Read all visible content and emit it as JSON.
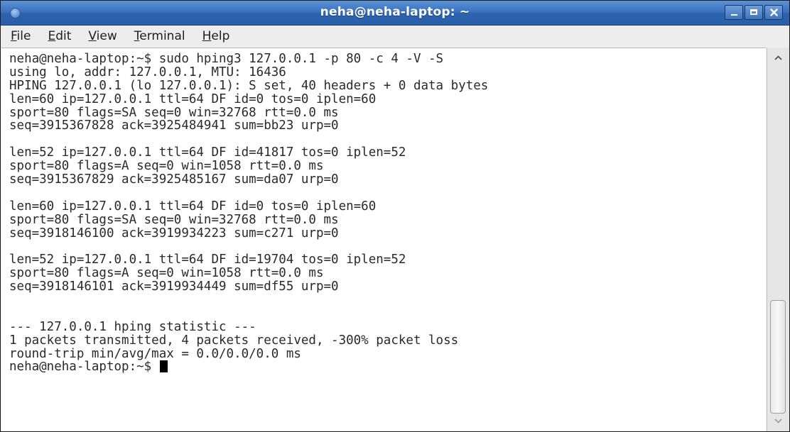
{
  "window": {
    "title": "neha@neha-laptop: ~"
  },
  "menu": [
    {
      "accel": "F",
      "rest": "ile"
    },
    {
      "accel": "E",
      "rest": "dit"
    },
    {
      "accel": "V",
      "rest": "iew"
    },
    {
      "accel": "T",
      "rest": "erminal"
    },
    {
      "accel": "H",
      "rest": "elp"
    }
  ],
  "terminal": {
    "lines": [
      "neha@neha-laptop:~$ sudo hping3 127.0.0.1 -p 80 -c 4 -V -S",
      "using lo, addr: 127.0.0.1, MTU: 16436",
      "HPING 127.0.0.1 (lo 127.0.0.1): S set, 40 headers + 0 data bytes",
      "len=60 ip=127.0.0.1 ttl=64 DF id=0 tos=0 iplen=60",
      "sport=80 flags=SA seq=0 win=32768 rtt=0.0 ms",
      "seq=3915367828 ack=3925484941 sum=bb23 urp=0",
      "",
      "len=52 ip=127.0.0.1 ttl=64 DF id=41817 tos=0 iplen=52",
      "sport=80 flags=A seq=0 win=1058 rtt=0.0 ms",
      "seq=3915367829 ack=3925485167 sum=da07 urp=0",
      "",
      "len=60 ip=127.0.0.1 ttl=64 DF id=0 tos=0 iplen=60",
      "sport=80 flags=SA seq=0 win=32768 rtt=0.0 ms",
      "seq=3918146100 ack=3919934223 sum=c271 urp=0",
      "",
      "len=52 ip=127.0.0.1 ttl=64 DF id=19704 tos=0 iplen=52",
      "sport=80 flags=A seq=0 win=1058 rtt=0.0 ms",
      "seq=3918146101 ack=3919934449 sum=df55 urp=0",
      "",
      "",
      "--- 127.0.0.1 hping statistic ---",
      "1 packets transmitted, 4 packets received, -300% packet loss",
      "round-trip min/avg/max = 0.0/0.0/0.0 ms"
    ],
    "prompt": "neha@neha-laptop:~$ "
  },
  "scrollbar": {
    "position": 0.92
  },
  "colors": {
    "titlebar": "#3a73bf",
    "terminal_bg": "#ffffff",
    "text": "#2a2a2a",
    "cursor": "#000000"
  }
}
